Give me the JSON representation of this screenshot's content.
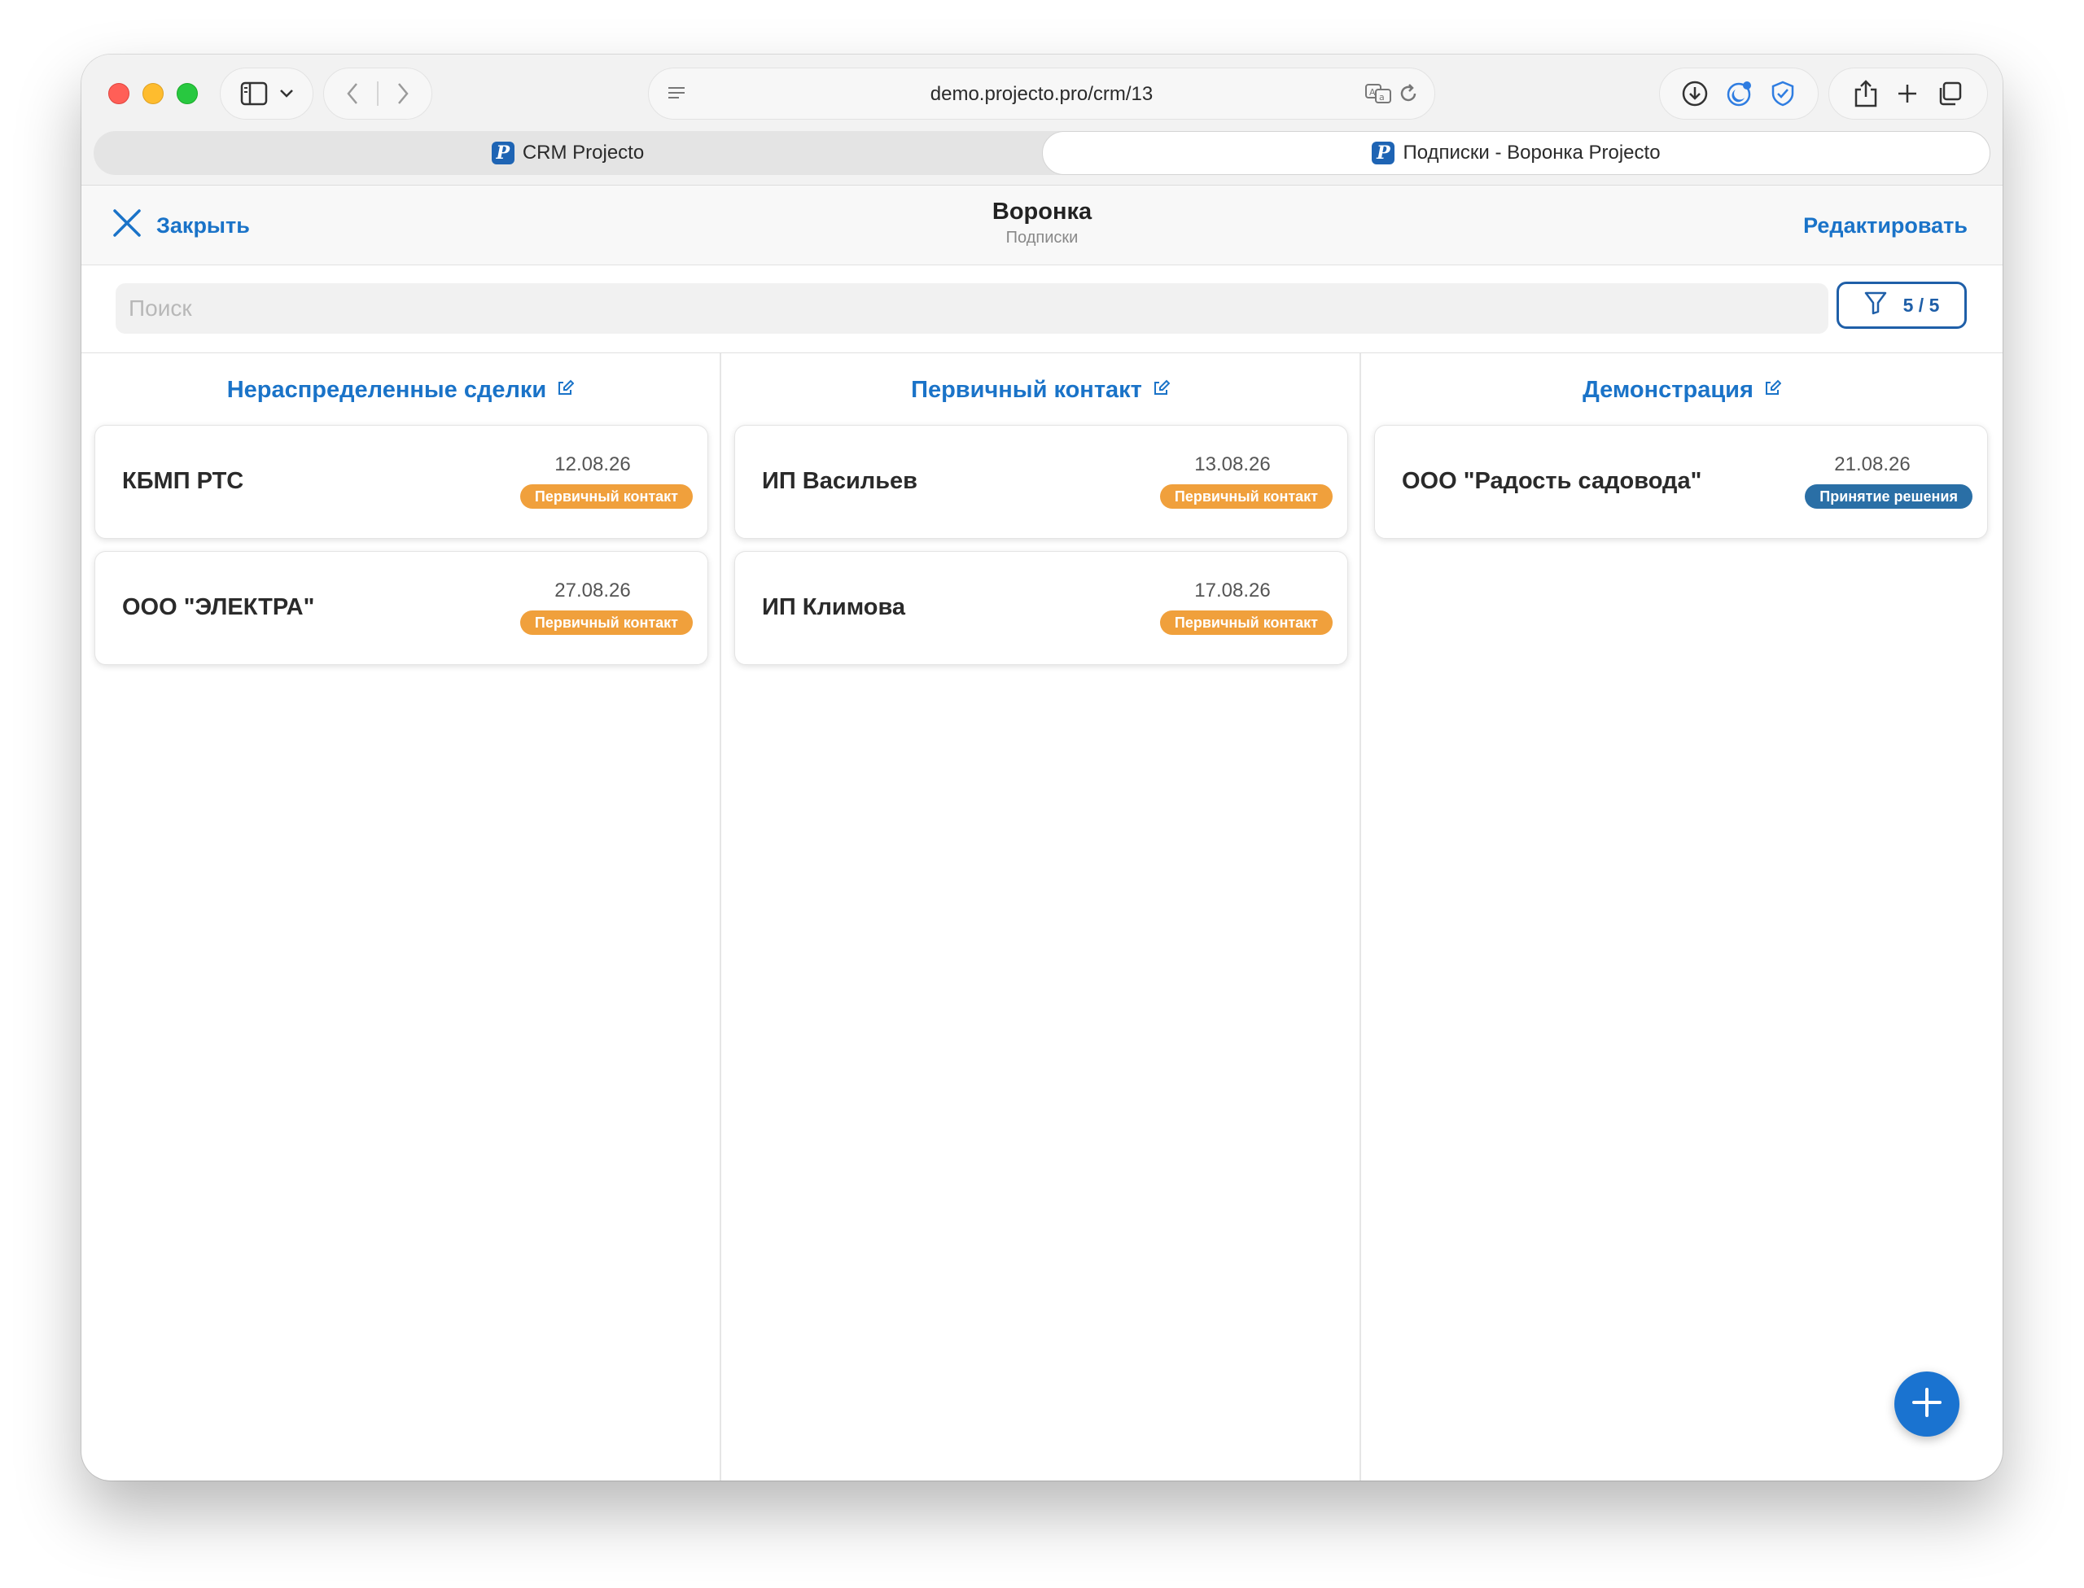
{
  "browser": {
    "url": "demo.projecto.pro/crm/13",
    "tabs": [
      {
        "label": "CRM Projecto",
        "active": false,
        "favicon": "P"
      },
      {
        "label": "Подписки - Воронка Projecto",
        "active": true,
        "favicon": "P"
      }
    ]
  },
  "header": {
    "close_label": "Закрыть",
    "title": "Воронка",
    "subtitle": "Подписки",
    "edit_label": "Редактировать"
  },
  "search": {
    "placeholder": "Поиск",
    "filter_count": "5 / 5"
  },
  "colors": {
    "accent": "#1a73c8",
    "badge_orange": "#f0a03c",
    "badge_blue": "#2a6fa6"
  },
  "columns": [
    {
      "title": "Нераспределенные сделки",
      "cards": [
        {
          "name": "КБМП РТС",
          "date": "12.08.26",
          "stage": "Первичный контакт"
        },
        {
          "name": "ООО \"ЭЛЕКТРА\"",
          "date": "27.08.26",
          "stage": "Первичный контакт"
        }
      ]
    },
    {
      "title": "Первичный контакт",
      "cards": [
        {
          "name": "ИП Васильев",
          "date": "13.08.26",
          "stage": "Первичный контакт"
        },
        {
          "name": "ИП Климова",
          "date": "17.08.26",
          "stage": "Первичный контакт"
        }
      ]
    },
    {
      "title": "Демонстрация",
      "cards": [
        {
          "name": "ООО \"Радость садовода\"",
          "date": "21.08.26",
          "stage": "Принятие решения"
        }
      ]
    }
  ]
}
